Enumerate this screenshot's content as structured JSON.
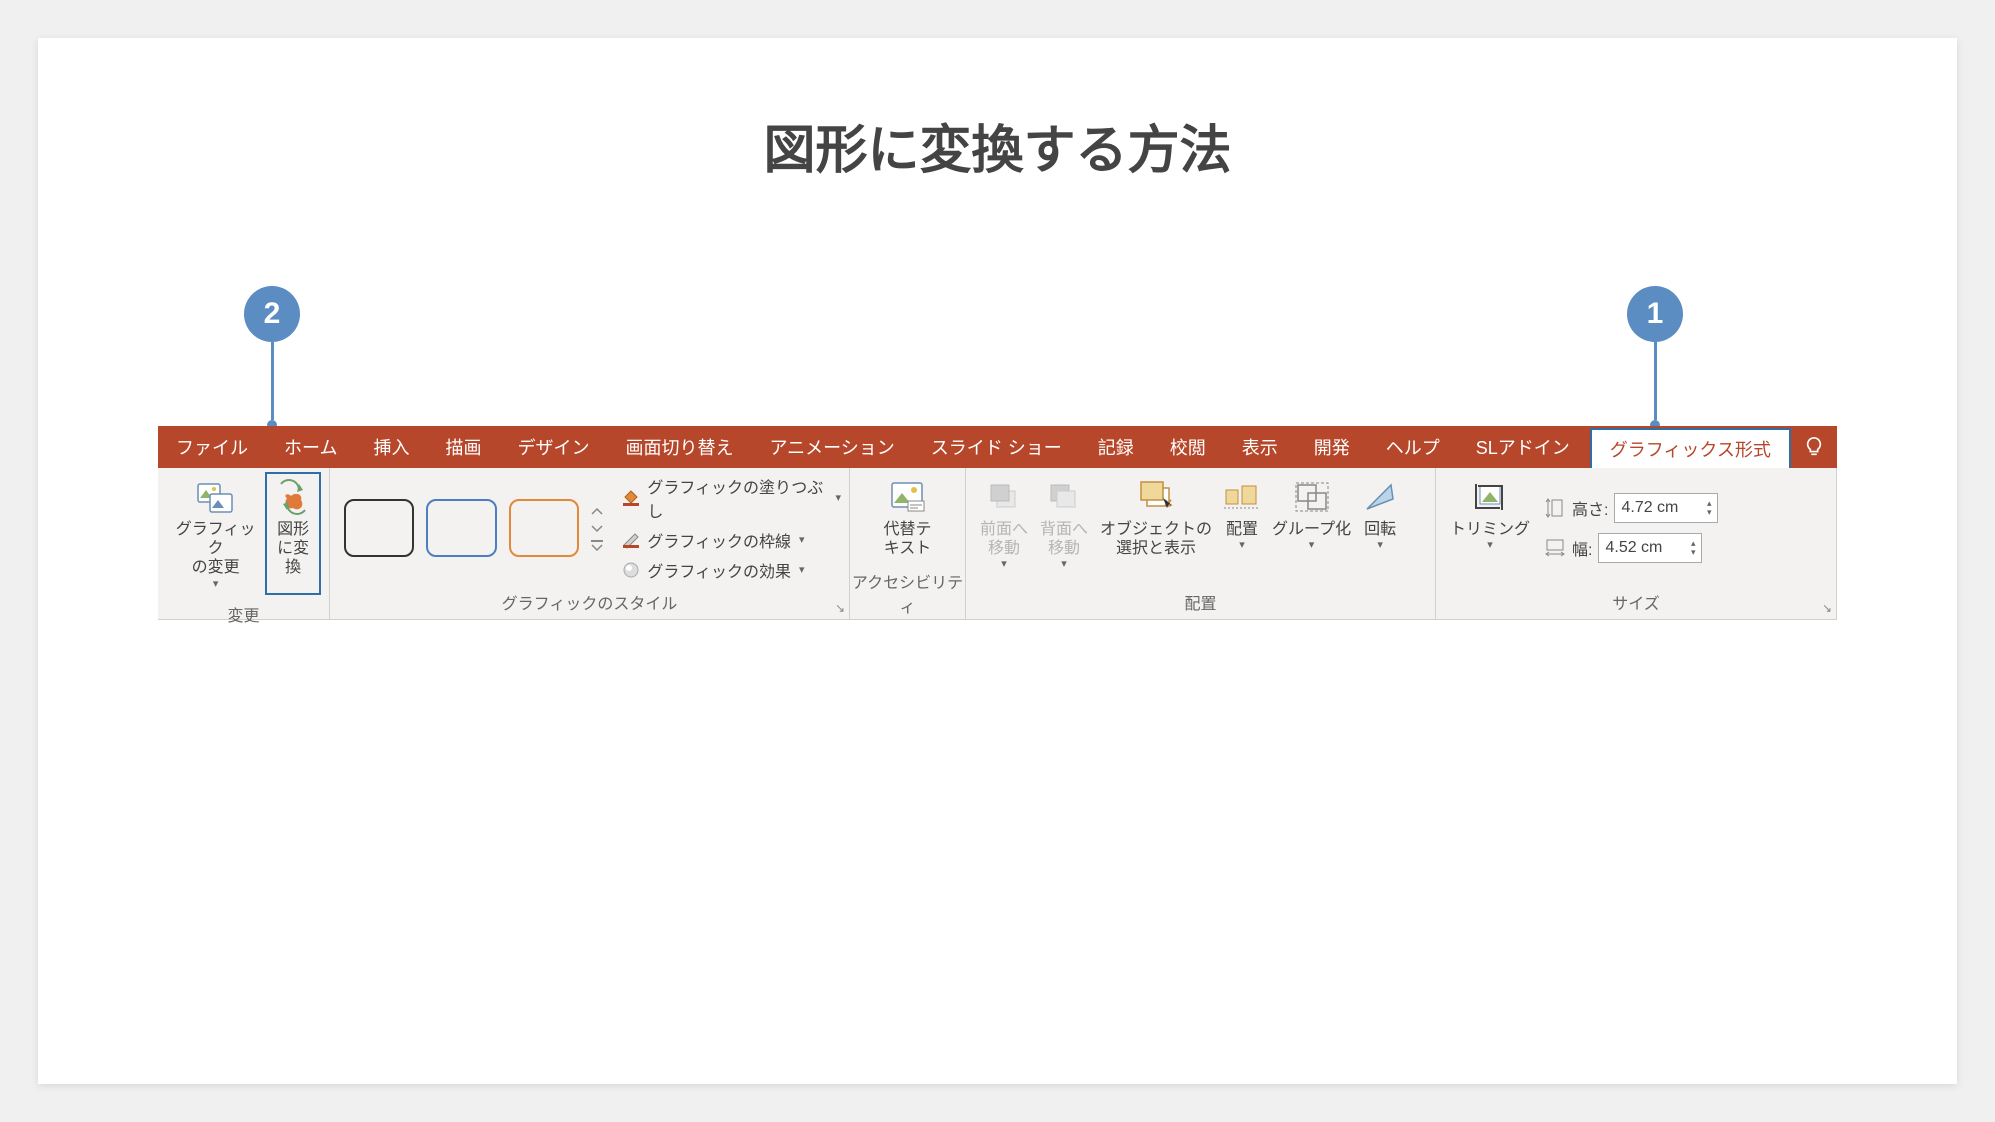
{
  "title": "図形に変換する方法",
  "callouts": {
    "c1": "1",
    "c2": "2"
  },
  "tabs": {
    "file": "ファイル",
    "home": "ホーム",
    "insert": "挿入",
    "draw": "描画",
    "design": "デザイン",
    "transitions": "画面切り替え",
    "animations": "アニメーション",
    "slideshow": "スライド ショー",
    "record": "記録",
    "review": "校閲",
    "view": "表示",
    "developer": "開発",
    "help": "ヘルプ",
    "sladdin": "SLアドイン",
    "graphicsFormat": "グラフィックス形式"
  },
  "groups": {
    "change": {
      "label": "変更",
      "changeGraphic": "グラフィック\nの変更",
      "convertToShape": "図形\nに変換"
    },
    "styles": {
      "label": "グラフィックのスタイル",
      "fill": "グラフィックの塗りつぶし",
      "outline": "グラフィックの枠線",
      "effects": "グラフィックの効果"
    },
    "accessibility": {
      "label": "アクセシビリティ",
      "altText": "代替テ\nキスト"
    },
    "arrange": {
      "label": "配置",
      "bringForward": "前面へ\n移動",
      "sendBackward": "背面へ\n移動",
      "selectionPane": "オブジェクトの\n選択と表示",
      "align": "配置",
      "group": "グループ化",
      "rotate": "回転"
    },
    "size": {
      "label": "サイズ",
      "crop": "トリミング",
      "heightLabel": "高さ:",
      "heightValue": "4.72 cm",
      "widthLabel": "幅:",
      "widthValue": "4.52 cm"
    }
  }
}
